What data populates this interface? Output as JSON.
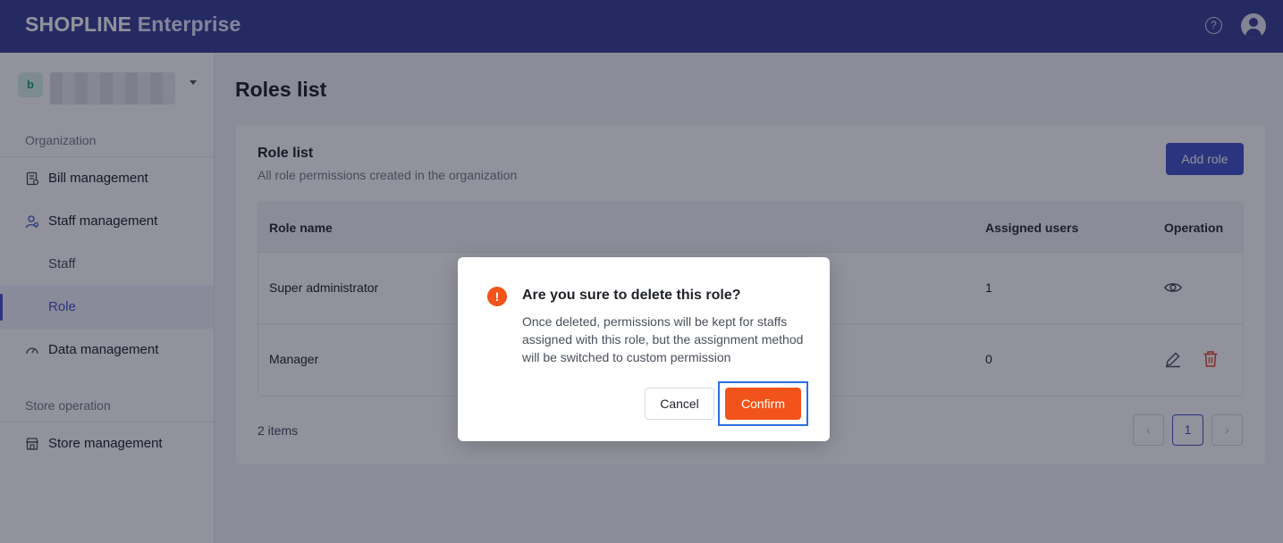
{
  "app": {
    "brand_prefix": "SHOPLINE",
    "brand_suffix": "Enterprise",
    "help_icon": "?"
  },
  "sidebar": {
    "org_initial": "b",
    "sections": [
      {
        "title": "Organization"
      },
      {
        "title": "Store operation"
      }
    ],
    "items": [
      {
        "label": "Bill management",
        "icon": "bill-icon"
      },
      {
        "label": "Staff management",
        "icon": "staff-icon"
      },
      {
        "label": "Staff"
      },
      {
        "label": "Role",
        "active": true
      },
      {
        "label": "Data management",
        "icon": "gauge-icon"
      },
      {
        "label": "Store management",
        "icon": "store-icon"
      }
    ]
  },
  "main": {
    "page_title": "Roles list",
    "card_title": "Role list",
    "card_subtitle": "All role permissions created in the organization",
    "add_button": "Add role",
    "table": {
      "columns": [
        "Role name",
        "Assigned users",
        "Operation"
      ],
      "rows": [
        {
          "name": "Super administrator",
          "assigned": "1",
          "operations": [
            "view-icon"
          ]
        },
        {
          "name": "Manager",
          "assigned": "0",
          "operations": [
            "edit-icon",
            "delete-icon"
          ]
        }
      ]
    },
    "items_count": "2 items",
    "pagination": {
      "prev": "‹",
      "current": "1",
      "next": "›"
    }
  },
  "modal": {
    "icon": "!",
    "title": "Are you sure to delete this role?",
    "body": "Once deleted, permissions will be kept for staffs assigned with this role, but the assignment method will be switched to custom permission",
    "cancel_label": "Cancel",
    "confirm_label": "Confirm"
  },
  "colors": {
    "topbar": "#3c4396",
    "accent": "#4654c8",
    "danger": "#f2531a",
    "focus_outline": "#2b6fe0"
  }
}
